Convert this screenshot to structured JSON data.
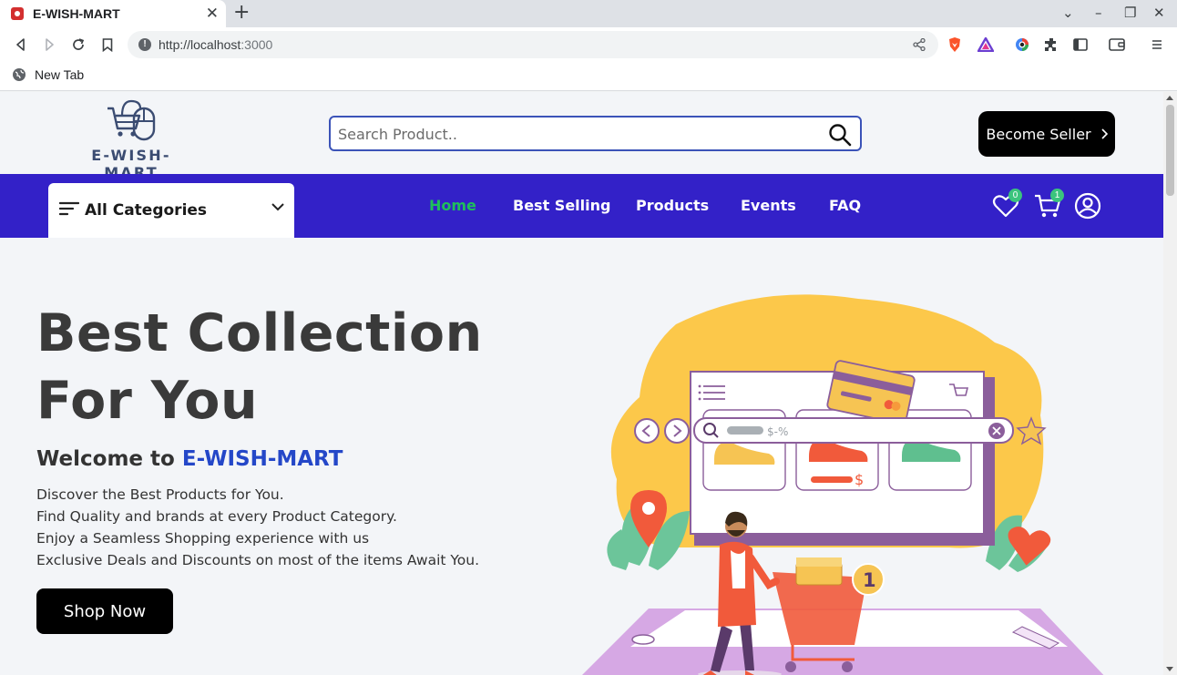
{
  "browser": {
    "tab_title": "E-WISH-MART",
    "url_host": "http://localhost",
    "url_port": ":3000",
    "bookmark_label": "New Tab"
  },
  "header": {
    "logo_text": "E-WISH-MART",
    "search_placeholder": "Search Product..",
    "seller_button": "Become Seller"
  },
  "navbar": {
    "categories_label": "All Categories",
    "links": [
      "Home",
      "Best Selling",
      "Products",
      "Events",
      "FAQ"
    ],
    "active_link": "Home",
    "wishlist_count": "0",
    "cart_count": "1"
  },
  "hero": {
    "title_line1": "Best Collection",
    "title_line2": "For You",
    "welcome_prefix": "Welcome to",
    "welcome_brand": "E-WISH-MART",
    "lines": [
      "Discover the Best Products for You.",
      "Find Quality and brands at every Product Category.",
      "Enjoy a Seamless Shopping experience with us",
      "Exclusive Deals and Discounts on most of the items Await You."
    ],
    "cta": "Shop Now"
  },
  "illustration": {
    "search_text": "$-%",
    "discount_label": "-%",
    "price_symbol": "$",
    "cart_item_count": "1"
  },
  "colors": {
    "navbar": "#3321c8",
    "active_link": "#1fbf5b",
    "brand_blue": "#2447c8",
    "button": "#000000"
  }
}
